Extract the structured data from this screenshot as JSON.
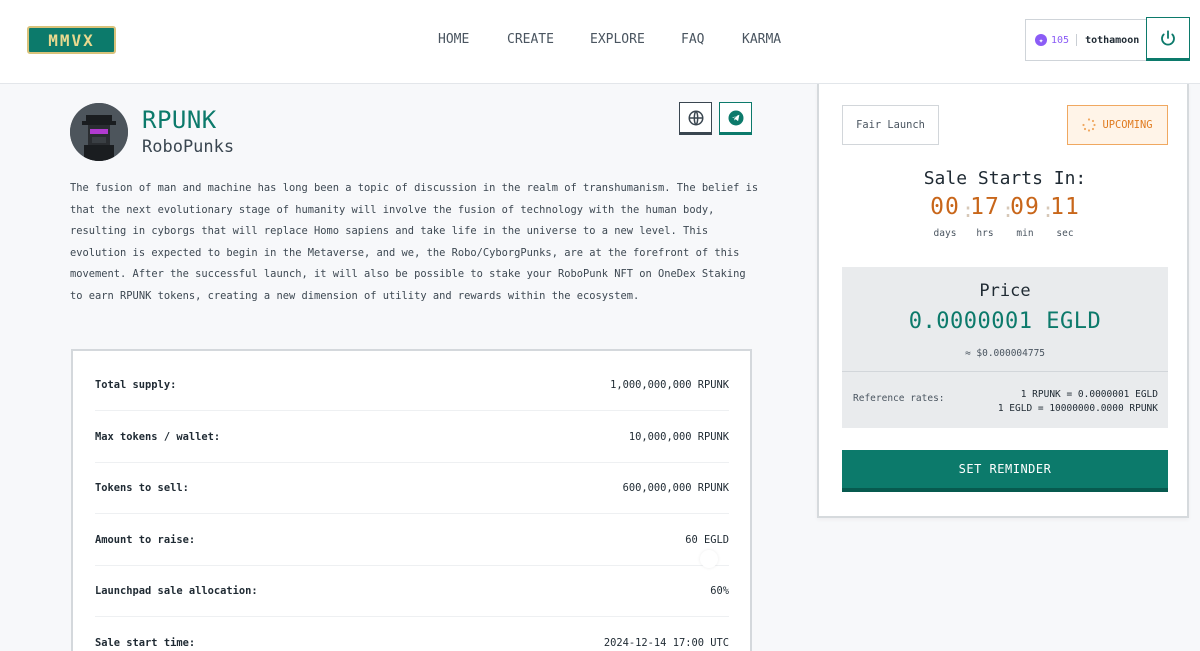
{
  "header": {
    "logo_text": "MMVX",
    "nav": [
      "HOME",
      "CREATE",
      "EXPLORE",
      "FAQ",
      "KARMA"
    ],
    "karma_points": "105",
    "username": "tothamoon",
    "accent_color": "#0c7a6b"
  },
  "token": {
    "symbol": "RPUNK",
    "name": "RoboPunks",
    "description": "The fusion of man and machine has long been a topic of discussion in the realm of transhumanism. The belief is that the next evolutionary stage of humanity will involve the fusion of technology with the human body, resulting in cyborgs that will replace Homo sapiens and take life in the universe to a new level. This evolution is expected to begin in the Metaverse, and we, the Robo/CyborgPunks, are at the forefront of this movement. After the successful launch, it will also be possible to stake your RoboPunk NFT on OneDex Staking to earn RPUNK tokens, creating a new dimension of utility and rewards within the ecosystem.",
    "social_icons": [
      "globe-icon",
      "telegram-icon"
    ]
  },
  "info": [
    {
      "label": "Total supply:",
      "value": "1,000,000,000 RPUNK"
    },
    {
      "label": "Max tokens / wallet:",
      "value": "10,000,000 RPUNK"
    },
    {
      "label": "Tokens to sell:",
      "value": "600,000,000 RPUNK"
    },
    {
      "label": "Amount to raise:",
      "value": "60 EGLD"
    },
    {
      "label": "Launchpad sale allocation:",
      "value": "60%"
    },
    {
      "label": "Sale start time:",
      "value": "2024-12-14 17:00 UTC"
    }
  ],
  "sale": {
    "launch_type": "Fair Launch",
    "status": "UPCOMING",
    "status_color": "#e07b20",
    "countdown_title": "Sale Starts In:",
    "countdown": [
      {
        "value": "00",
        "label": "days"
      },
      {
        "value": "17",
        "label": "hrs"
      },
      {
        "value": "09",
        "label": "min"
      },
      {
        "value": "11",
        "label": "sec"
      }
    ],
    "price_title": "Price",
    "price": "0.0000001 EGLD",
    "price_usd": "≈ $0.000004775",
    "ref_label": "Reference rates:",
    "ref_rate_1": "1 RPUNK = 0.0000001 EGLD",
    "ref_rate_2": "1 EGLD = 10000000.0000 RPUNK",
    "reminder_button": "SET REMINDER"
  }
}
